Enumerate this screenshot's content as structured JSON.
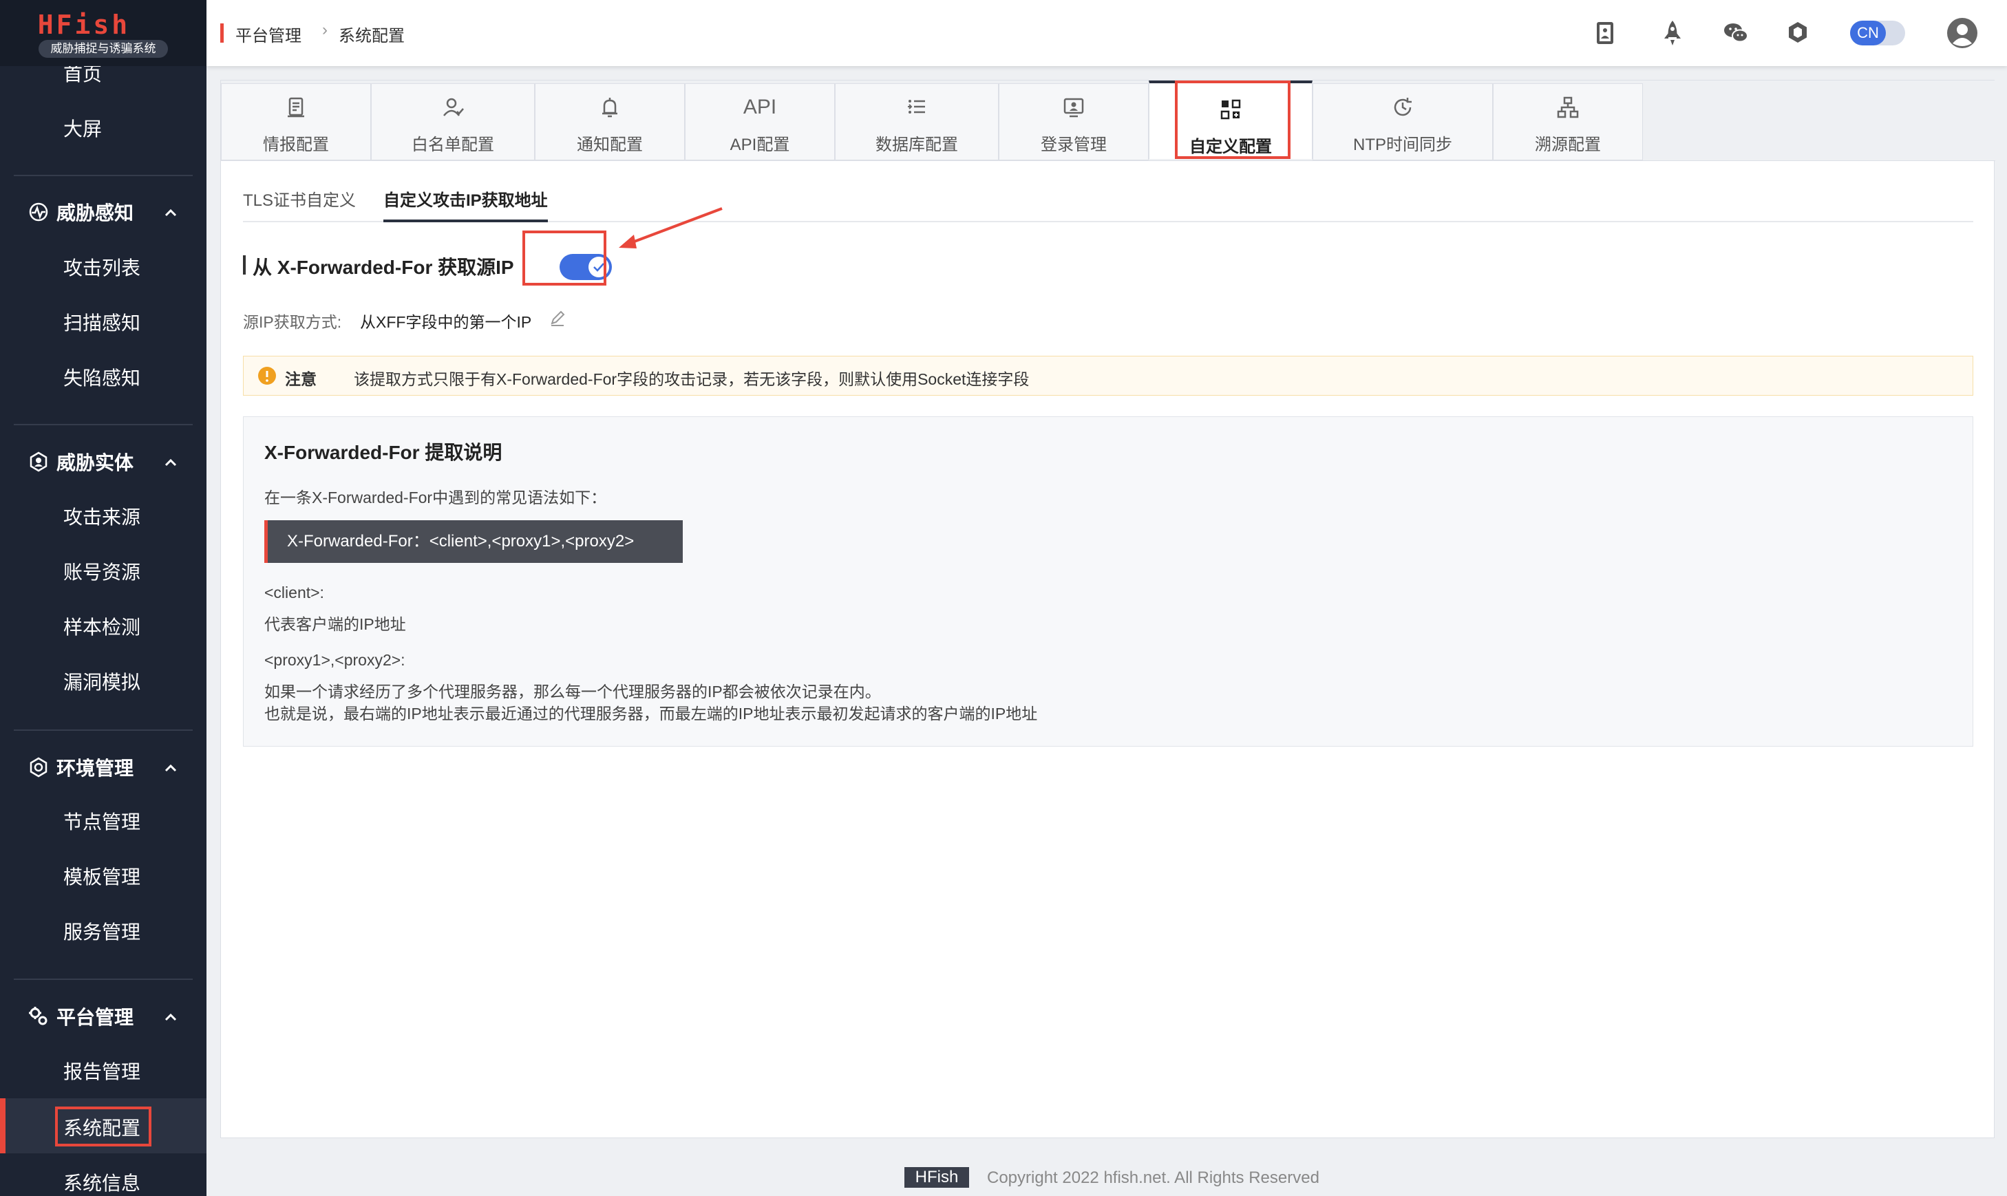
{
  "sidebar": {
    "logo": "HFish",
    "logo_subtitle": "威胁捕捉与诱骗系统",
    "top_items": [
      "首页",
      "大屏"
    ],
    "groups": [
      {
        "label": "威胁感知",
        "icon": "radar-icon",
        "items": [
          "攻击列表",
          "扫描感知",
          "失陷感知"
        ]
      },
      {
        "label": "威胁实体",
        "icon": "hexagon-shield-icon",
        "items": [
          "攻击来源",
          "账号资源",
          "样本检测",
          "漏洞模拟"
        ]
      },
      {
        "label": "环境管理",
        "icon": "gear-hexagon-icon",
        "items": [
          "节点管理",
          "模板管理",
          "服务管理"
        ]
      },
      {
        "label": "平台管理",
        "icon": "gears-icon",
        "items": [
          "报告管理",
          "系统配置",
          "系统信息"
        ]
      }
    ],
    "active_item": "系统配置"
  },
  "header": {
    "breadcrumb": [
      "平台管理",
      "系统配置"
    ],
    "breadcrumb_sep": "›",
    "icons": [
      "manual-book-icon",
      "rocket-icon",
      "wechat-icon",
      "hexagon-icon"
    ],
    "lang": "CN"
  },
  "tabs": [
    {
      "label": "情报配置",
      "icon": "intel-icon"
    },
    {
      "label": "白名单配置",
      "icon": "user-whitelist-icon"
    },
    {
      "label": "通知配置",
      "icon": "bell-icon"
    },
    {
      "label": "API配置",
      "icon_text": "API"
    },
    {
      "label": "数据库配置",
      "icon": "database-list-icon"
    },
    {
      "label": "登录管理",
      "icon": "login-screen-icon"
    },
    {
      "label": "自定义配置",
      "icon": "grid-plus-icon"
    },
    {
      "label": "NTP时间同步",
      "icon": "clock-sync-icon"
    },
    {
      "label": "溯源配置",
      "icon": "network-tree-icon"
    }
  ],
  "active_tab": "自定义配置",
  "subtabs": [
    "TLS证书自定义",
    "自定义攻击IP获取地址"
  ],
  "active_subtab": "自定义攻击IP获取地址",
  "xff": {
    "label": "从 X-Forwarded-For 获取源IP",
    "enabled": true,
    "method_key": "源IP获取方式:",
    "method_value": "从XFF字段中的第一个IP"
  },
  "notice": {
    "title": "注意",
    "text": "该提取方式只限于有X-Forwarded-For字段的攻击记录，若无该字段，则默认使用Socket连接字段"
  },
  "explain": {
    "title": "X-Forwarded-For 提取说明",
    "intro": "在一条X-Forwarded-For中遇到的常见语法如下：",
    "code": "X-Forwarded-For：<client>,<proxy1>,<proxy2>",
    "client_key": "<client>:",
    "client_desc": "代表客户端的IP地址",
    "proxy_key": "<proxy1>,<proxy2>:",
    "proxy_desc1": "如果一个请求经历了多个代理服务器，那么每一个代理服务器的IP都会被依次记录在内。",
    "proxy_desc2": "也就是说，最右端的IP地址表示最近通过的代理服务器，而最左端的IP地址表示最初发起请求的客户端的IP地址"
  },
  "footer": {
    "brand": "HFish",
    "copyright": "Copyright 2022 hfish.net. All Rights Reserved"
  },
  "colors": {
    "sidebar_bg": "#1d2433",
    "accent_red": "#e8473b",
    "switch_blue": "#3f6fe0"
  }
}
